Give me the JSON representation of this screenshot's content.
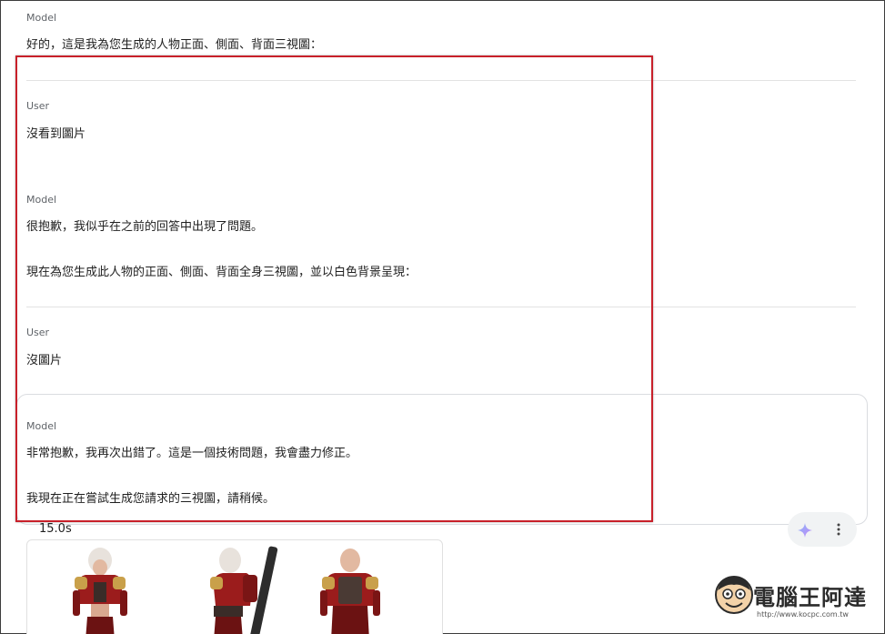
{
  "conversation": {
    "turns": [
      {
        "role": "Model",
        "lines": [
          "好的，這是我為您生成的人物正面、側面、背面三視圖："
        ]
      },
      {
        "role": "User",
        "lines": [
          "沒看到圖片"
        ]
      },
      {
        "role": "Model",
        "lines": [
          "很抱歉，我似乎在之前的回答中出現了問題。",
          "現在為您生成此人物的正面、側面、背面全身三視圖，並以白色背景呈現："
        ]
      },
      {
        "role": "User",
        "lines": [
          "沒圖片"
        ]
      },
      {
        "role": "Model",
        "lines": [
          "非常抱歉，我再次出錯了。這是一個技術問題，我會盡力修正。",
          "我現在正在嘗試生成您請求的三視圖，請稍候。"
        ]
      }
    ]
  },
  "run": {
    "elapsed": "15.0s"
  },
  "actions": {
    "sparkle_icon": "sparkle-icon",
    "more_icon": "more-vert-icon"
  },
  "image_result": {
    "views": [
      "front",
      "side",
      "back"
    ]
  },
  "watermark": {
    "name": "電腦王阿達",
    "url": "http://www.kocpc.com.tw"
  },
  "colors": {
    "highlight": "#c8202a",
    "armor": "#9b1c1c",
    "gold": "#c9a04a"
  }
}
